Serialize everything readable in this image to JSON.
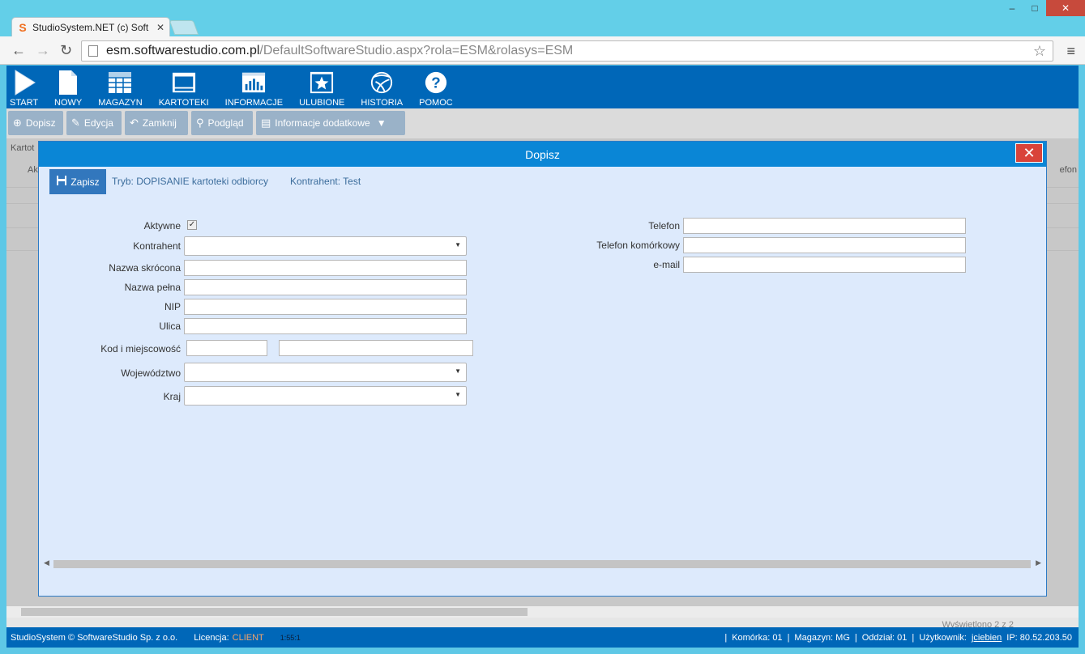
{
  "browser": {
    "tab_title": "StudioSystem.NET (c) Soft",
    "url_host": "esm.softwarestudio.com.pl",
    "url_path": "/DefaultSoftwareStudio.aspx?rola=ESM&rolasys=ESM"
  },
  "toolbar": {
    "items": [
      {
        "label": "START",
        "icon": "play-icon"
      },
      {
        "label": "NOWY",
        "icon": "document-icon"
      },
      {
        "label": "MAGAZYN",
        "icon": "grid-icon"
      },
      {
        "label": "KARTOTEKI",
        "icon": "window-icon"
      },
      {
        "label": "INFORMACJE",
        "icon": "chart-icon"
      },
      {
        "label": "ULUBIONE",
        "icon": "star-icon"
      },
      {
        "label": "HISTORIA",
        "icon": "swirl-icon"
      },
      {
        "label": "POMOC",
        "icon": "help-icon"
      }
    ]
  },
  "actions": {
    "add": "Dopisz",
    "edit": "Edycja",
    "close": "Zamknij",
    "preview": "Podgląd",
    "info": "Informacje dodatkowe"
  },
  "background": {
    "kart": "Kartot",
    "ak": "Ak",
    "tel": "efon",
    "shown": "Wyświetlono 2 z 2"
  },
  "modal": {
    "title": "Dopisz",
    "save_label": "Zapisz",
    "mode": "Tryb: DOPISANIE kartoteki odbiorcy",
    "contractor": "Kontrahent: Test"
  },
  "form": {
    "active_label": "Aktywne",
    "kontrahent_label": "Kontrahent",
    "short_name_label": "Nazwa skrócona",
    "full_name_label": "Nazwa pełna",
    "nip_label": "NIP",
    "street_label": "Ulica",
    "postal_city_label": "Kod i miejscowość",
    "voivodeship_label": "Województwo",
    "country_label": "Kraj",
    "phone_label": "Telefon",
    "mobile_label": "Telefon komórkowy",
    "email_label": "e-mail"
  },
  "footer": {
    "copyright": "StudioSystem © SoftwareStudio Sp. z o.o.",
    "license_label": "Licencja:",
    "license_value": "CLIENT",
    "clock": "1:55:1",
    "komorka": "Komórka: 01",
    "magazyn": "Magazyn: MG",
    "oddzial": "Oddział: 01",
    "user_label": "Użytkownik:",
    "user": "jciebien",
    "ip": "IP: 80.52.203.50"
  }
}
